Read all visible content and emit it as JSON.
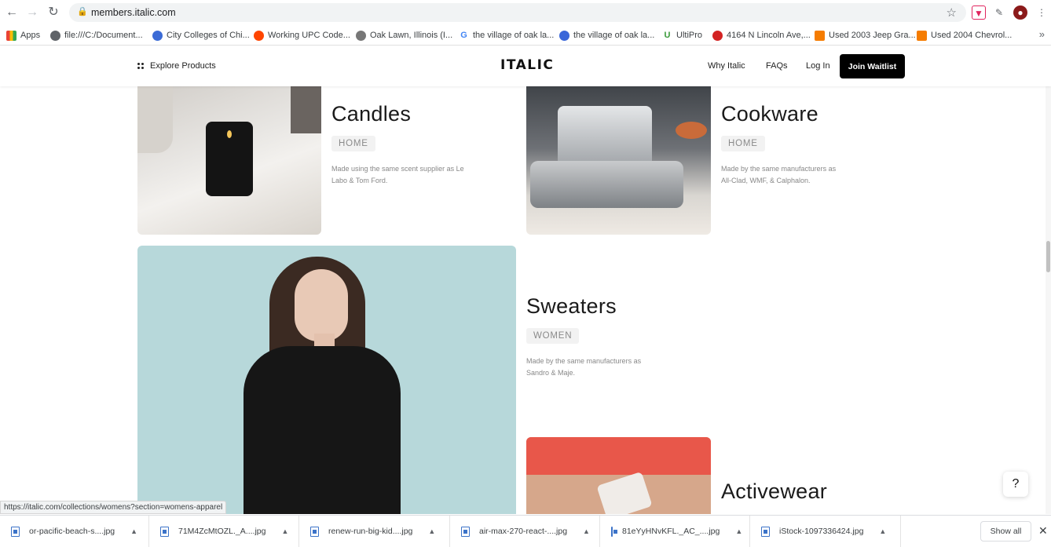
{
  "browser": {
    "url": "members.italic.com",
    "status_url": "https://italic.com/collections/womens?section=womens-apparel",
    "bookmarks": [
      {
        "label": "Apps",
        "icon": "apps-grid-icon",
        "color": "#e8453c"
      },
      {
        "label": "file:///C:/Document...",
        "icon": "globe-icon",
        "color": "#5f6368"
      },
      {
        "label": "City Colleges of Chi...",
        "icon": "ccc-icon",
        "color": "#3b6bd6"
      },
      {
        "label": "Working UPC Code...",
        "icon": "reddit-icon",
        "color": "#ff4500"
      },
      {
        "label": "Oak Lawn, Illinois (I...",
        "icon": "wiki-icon",
        "color": "#777777"
      },
      {
        "label": "the village of oak la...",
        "icon": "google-icon",
        "color": "#4285f4"
      },
      {
        "label": "the village of oak la...",
        "icon": "site-icon",
        "color": "#3a67d9"
      },
      {
        "label": "UltiPro",
        "icon": "ultipro-icon",
        "color": "#3a9a3a"
      },
      {
        "label": "4164 N Lincoln Ave,...",
        "icon": "yelp-icon",
        "color": "#d32323"
      },
      {
        "label": "Used 2003 Jeep Gra...",
        "icon": "autotrader-icon",
        "color": "#f57c00"
      },
      {
        "label": "Used 2004 Chevrol...",
        "icon": "autotrader-icon",
        "color": "#f57c00"
      }
    ],
    "more_bookmarks": "»"
  },
  "header": {
    "explore": "Explore Products",
    "logo": "ITALIC",
    "nav": [
      "Why Italic",
      "FAQs",
      "Log In"
    ],
    "cta": "Join Waitlist"
  },
  "products": [
    {
      "title": "Candles",
      "tag": "HOME",
      "desc": "Made using the same scent supplier as Le Labo & Tom Ford."
    },
    {
      "title": "Cookware",
      "tag": "HOME",
      "desc": "Made by the same manufacturers as All-Clad, WMF, & Calphalon."
    },
    {
      "title": "Sweaters",
      "tag": "WOMEN",
      "desc": "Made by the same manufacturers as Sandro & Maje."
    },
    {
      "title": "Activewear",
      "tag": "",
      "desc": ""
    }
  ],
  "help": "?",
  "downloads": {
    "items": [
      "or-pacific-beach-s....jpg",
      "71M4ZcMtOZL._A....jpg",
      "renew-run-big-kid....jpg",
      "air-max-270-react-....jpg",
      "81eYyHNvKFL._AC_....jpg",
      "iStock-1097336424.jpg"
    ],
    "show_all": "Show all",
    "close": "✕"
  },
  "colors": {
    "cta_bg": "#000000",
    "tag_bg": "#f2f2f2",
    "sweater_bg": "#b7d8da",
    "activewear_bg": "#e8574a"
  }
}
